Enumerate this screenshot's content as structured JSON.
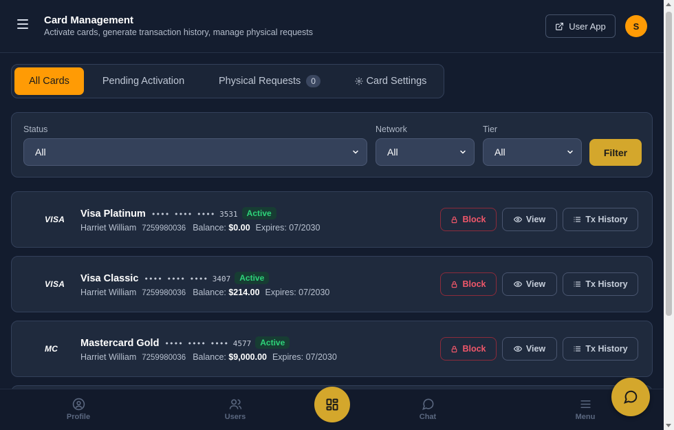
{
  "header": {
    "title": "Card Management",
    "subtitle": "Activate cards, generate transaction history, manage physical requests",
    "user_app_label": "User App",
    "avatar_initial": "S",
    "menu_icon": "hamburger-icon",
    "user_app_icon": "external-link-icon"
  },
  "tabs": [
    {
      "label": "All Cards",
      "active": true
    },
    {
      "label": "Pending Activation"
    },
    {
      "label": "Physical Requests",
      "badge": "0"
    },
    {
      "label": "Card Settings",
      "icon": "gear-icon"
    }
  ],
  "filters": {
    "status_label": "Status",
    "status_value": "All",
    "network_label": "Network",
    "network_value": "All",
    "tier_label": "Tier",
    "tier_value": "All",
    "filter_button": "Filter"
  },
  "cards": [
    {
      "network": "VISA",
      "name": "Visa Platinum",
      "masked": "•••• •••• ••••",
      "last4": "3531",
      "status": "Active",
      "holder": "Harriet William",
      "account": "7259980036",
      "balance_label": "Balance:",
      "balance": "$0.00",
      "expires": "Expires: 07/2030"
    },
    {
      "network": "VISA",
      "name": "Visa Classic",
      "masked": "•••• •••• ••••",
      "last4": "3407",
      "status": "Active",
      "holder": "Harriet William",
      "account": "7259980036",
      "balance_label": "Balance:",
      "balance": "$214.00",
      "expires": "Expires: 07/2030"
    },
    {
      "network": "MC",
      "name": "Mastercard Gold",
      "masked": "•••• •••• ••••",
      "last4": "4577",
      "status": "Active",
      "holder": "Harriet William",
      "account": "7259980036",
      "balance_label": "Balance:",
      "balance": "$9,000.00",
      "expires": "Expires: 07/2030"
    }
  ],
  "card_actions": {
    "block": "Block",
    "view": "View",
    "tx_history": "Tx History"
  },
  "bottom_nav": {
    "profile": "Profile",
    "users": "Users",
    "chat": "Chat",
    "menu": "Menu"
  },
  "colors": {
    "accent": "#ff9b05",
    "gold": "#d4a72c",
    "active_green": "#2ed47a",
    "danger": "#f0576a",
    "background": "#131c2e"
  }
}
